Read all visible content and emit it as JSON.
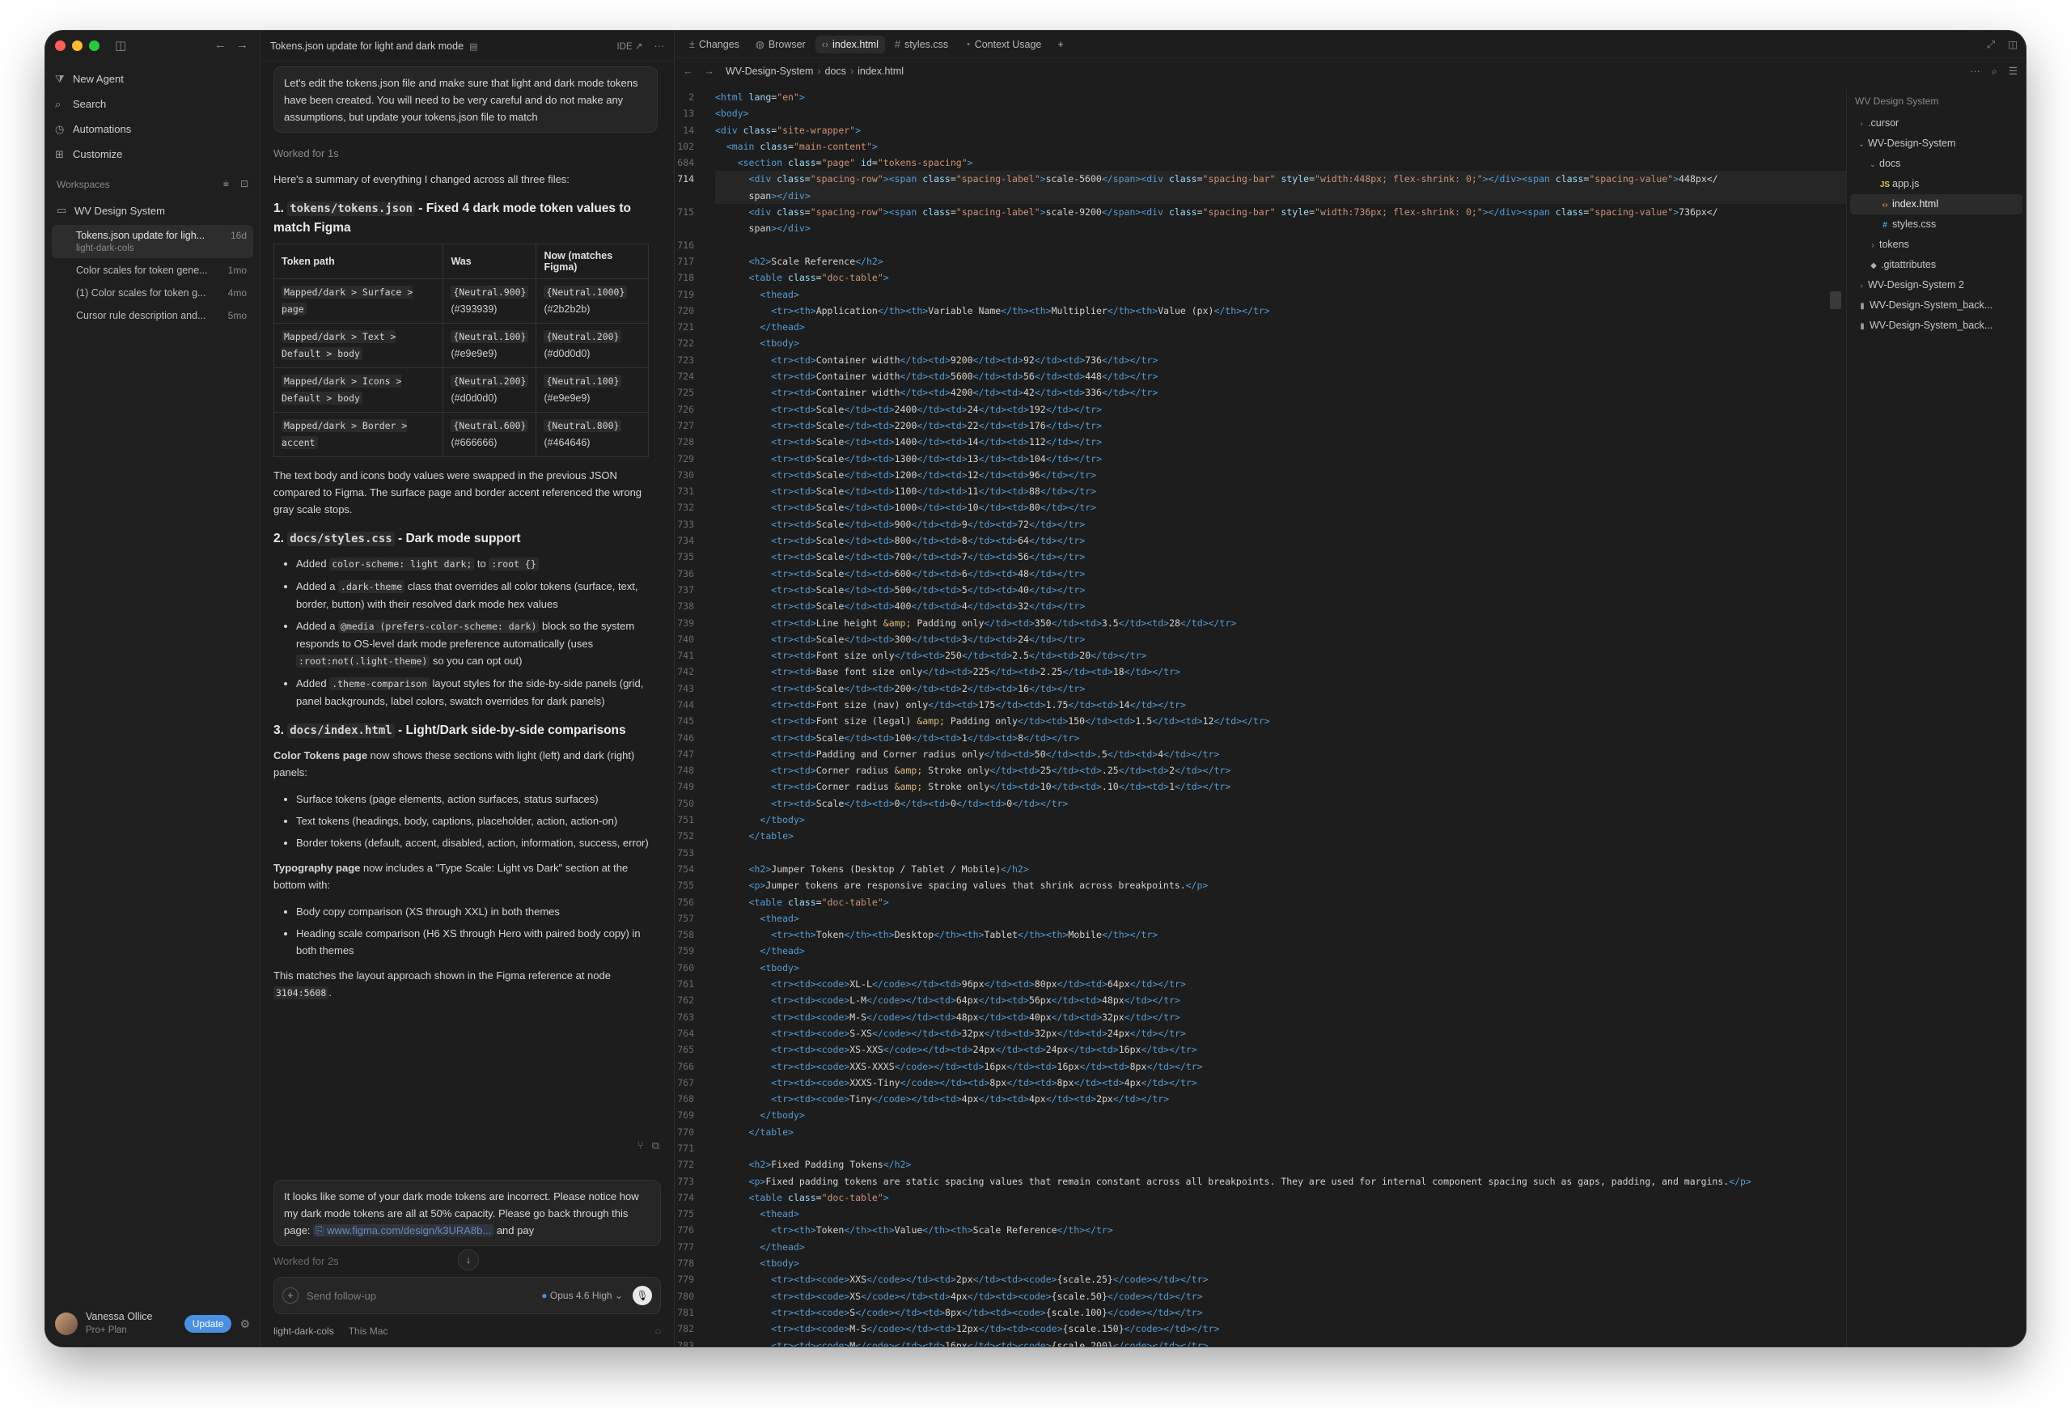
{
  "sidebar": {
    "menu": [
      {
        "icon": "agent-icon",
        "glyph": "⧩",
        "label": "New Agent"
      },
      {
        "icon": "search-icon",
        "glyph": "⌕",
        "label": "Search"
      },
      {
        "icon": "clock-icon",
        "glyph": "◷",
        "label": "Automations"
      },
      {
        "icon": "customize-icon",
        "glyph": "⊞",
        "label": "Customize"
      }
    ],
    "workspaces_label": "Workspaces",
    "workspace_name": "WV Design System",
    "threads": [
      {
        "title": "Tokens.json update for ligh...",
        "sub": "light-dark-cols",
        "age": "16d",
        "active": true
      },
      {
        "title": "Color scales for token gene...",
        "sub": "",
        "age": "1mo",
        "active": false
      },
      {
        "title": "(1) Color scales for token g...",
        "sub": "",
        "age": "4mo",
        "active": false
      },
      {
        "title": "Cursor rule description and...",
        "sub": "",
        "age": "5mo",
        "active": false
      }
    ],
    "user": {
      "name": "Vanessa Ollice",
      "plan": "Pro+ Plan",
      "update_label": "Update"
    }
  },
  "chat": {
    "title": "Tokens.json update for light and dark mode",
    "ide_label": "IDE ↗",
    "user_message": "Let's edit the tokens.json file and make sure that light and dark mode tokens have been created. You will need to be very careful and do not make any assumptions, but update your tokens.json file to match",
    "worked1": "Worked for 1s",
    "summary": "Here's a summary of everything I changed across all three files:",
    "s1_num": "1.",
    "s1_code": "tokens/tokens.json",
    "s1_rest": " - Fixed 4 dark mode token values to match Figma",
    "table_headers": [
      "Token path",
      "Was",
      "Now (matches Figma)"
    ],
    "table_rows": [
      {
        "path": "Mapped/dark > Surface > page",
        "was_token": "{Neutral.900}",
        "was_hex": "(#393939)",
        "now_token": "{Neutral.1000}",
        "now_hex": "(#2b2b2b)"
      },
      {
        "path": "Mapped/dark > Text > Default > body",
        "was_token": "{Neutral.100}",
        "was_hex": "(#e9e9e9)",
        "now_token": "{Neutral.200}",
        "now_hex": "(#d0d0d0)"
      },
      {
        "path": "Mapped/dark > Icons > Default > body",
        "was_token": "{Neutral.200}",
        "was_hex": "(#d0d0d0)",
        "now_token": "{Neutral.100}",
        "now_hex": "(#e9e9e9)"
      },
      {
        "path": "Mapped/dark > Border > accent",
        "was_token": "{Neutral.600}",
        "was_hex": "(#666666)",
        "now_token": "{Neutral.800}",
        "now_hex": "(#464646)"
      }
    ],
    "para1": "The text body and icons body values were swapped in the previous JSON compared to Figma. The surface page and border accent referenced the wrong gray scale stops.",
    "s2_num": "2.",
    "s2_code": "docs/styles.css",
    "s2_rest": " - Dark mode support",
    "s2_bullets": [
      {
        "pre": "Added ",
        "code": "color-scheme: light dark;",
        "mid": " to ",
        "code2": ":root {}",
        "post": ""
      },
      {
        "pre": "Added a ",
        "code": ".dark-theme",
        "mid": " class that overrides all color tokens (surface, text, border, button) with their resolved dark mode hex values",
        "code2": "",
        "post": ""
      },
      {
        "pre": "Added a ",
        "code": "@media (prefers-color-scheme: dark)",
        "mid": " block so the system responds to OS-level dark mode preference automatically (uses ",
        "code2": ":root:not(.light-theme)",
        "post": " so you can opt out)"
      },
      {
        "pre": "Added ",
        "code": ".theme-comparison",
        "mid": " layout styles for the side-by-side panels (grid, panel backgrounds, label colors, swatch overrides for dark panels)",
        "code2": "",
        "post": ""
      }
    ],
    "s3_num": "3.",
    "s3_code": "docs/index.html",
    "s3_rest": " - Light/Dark side-by-side comparisons",
    "color_page_bold": "Color Tokens page",
    "color_page_rest": " now shows these sections with light (left) and dark (right) panels:",
    "s3_bullets_a": [
      "Surface tokens (page elements, action surfaces, status surfaces)",
      "Text tokens (headings, body, captions, placeholder, action, action-on)",
      "Border tokens (default, accent, disabled, action, information, success, error)"
    ],
    "typo_bold": "Typography page",
    "typo_rest": " now includes a \"Type Scale: Light vs Dark\" section at the bottom with:",
    "s3_bullets_b": [
      "Body copy comparison (XS through XXL) in both themes",
      "Heading scale comparison (H6 XS through Hero with paired body copy) in both themes"
    ],
    "closing_pre": "This matches the layout approach shown in the Figma reference at node ",
    "closing_code": "3104:5608",
    "closing_post": ".",
    "user_message2_pre": "It looks like some of your dark mode tokens are incorrect. Please notice how my dark mode tokens are all at 50% capacity. Please go back through this page: ",
    "user_message2_link": "⎘ www.figma.com/design/k3URA8b...",
    "user_message2_post": " and pay",
    "worked2": "Worked for 2s",
    "composer_placeholder": "Send follow-up",
    "model_label": "Opus 4.6 High",
    "footer_branch": "light-dark-cols",
    "footer_location": "This Mac"
  },
  "editor": {
    "tabs": [
      {
        "icon": "changes-icon",
        "glyph": "±",
        "label": "Changes",
        "active": false
      },
      {
        "icon": "globe-icon",
        "glyph": "◍",
        "label": "Browser",
        "active": false
      },
      {
        "icon": "code-icon",
        "glyph": "‹›",
        "label": "index.html",
        "active": true
      },
      {
        "icon": "hash-icon",
        "glyph": "#",
        "label": "styles.css",
        "active": false
      },
      {
        "icon": "pie-icon",
        "glyph": "◔",
        "label": "Context Usage",
        "active": false
      }
    ],
    "breadcrumb": [
      "WV-Design-System",
      "docs",
      "index.html"
    ],
    "current_line": "714",
    "lines": [
      {
        "n": "2",
        "s": "<html lang=\"en\">"
      },
      {
        "n": "13",
        "s": "<body>"
      },
      {
        "n": "14",
        "s": "<div class=\"site-wrapper\">"
      },
      {
        "n": "102",
        "s": "  <main class=\"main-content\">"
      },
      {
        "n": "684",
        "s": "    <section class=\"page\" id=\"tokens-spacing\">"
      },
      {
        "n": "714",
        "s": "      <div class=\"spacing-row\"><span class=\"spacing-label\">scale-5600</span><div class=\"spacing-bar\" style=\"width:448px; flex-shrink: 0;\"></div><span class=\"spacing-value\">448px</"
      },
      {
        "n": "",
        "s": "      span></div>"
      },
      {
        "n": "715",
        "s": "      <div class=\"spacing-row\"><span class=\"spacing-label\">scale-9200</span><div class=\"spacing-bar\" style=\"width:736px; flex-shrink: 0;\"></div><span class=\"spacing-value\">736px</"
      },
      {
        "n": "",
        "s": "      span></div>"
      },
      {
        "n": "716",
        "s": ""
      },
      {
        "n": "717",
        "s": "      <h2>Scale Reference</h2>"
      },
      {
        "n": "718",
        "s": "      <table class=\"doc-table\">"
      },
      {
        "n": "719",
        "s": "        <thead>"
      },
      {
        "n": "720",
        "s": "          <tr><th>Application</th><th>Variable Name</th><th>Multiplier</th><th>Value (px)</th></tr>"
      },
      {
        "n": "721",
        "s": "        </thead>"
      },
      {
        "n": "722",
        "s": "        <tbody>"
      },
      {
        "n": "723",
        "s": "          <tr><td>Container width</td><td>9200</td><td>92</td><td>736</td></tr>"
      },
      {
        "n": "724",
        "s": "          <tr><td>Container width</td><td>5600</td><td>56</td><td>448</td></tr>"
      },
      {
        "n": "725",
        "s": "          <tr><td>Container width</td><td>4200</td><td>42</td><td>336</td></tr>"
      },
      {
        "n": "726",
        "s": "          <tr><td>Scale</td><td>2400</td><td>24</td><td>192</td></tr>"
      },
      {
        "n": "727",
        "s": "          <tr><td>Scale</td><td>2200</td><td>22</td><td>176</td></tr>"
      },
      {
        "n": "728",
        "s": "          <tr><td>Scale</td><td>1400</td><td>14</td><td>112</td></tr>"
      },
      {
        "n": "729",
        "s": "          <tr><td>Scale</td><td>1300</td><td>13</td><td>104</td></tr>"
      },
      {
        "n": "730",
        "s": "          <tr><td>Scale</td><td>1200</td><td>12</td><td>96</td></tr>"
      },
      {
        "n": "731",
        "s": "          <tr><td>Scale</td><td>1100</td><td>11</td><td>88</td></tr>"
      },
      {
        "n": "732",
        "s": "          <tr><td>Scale</td><td>1000</td><td>10</td><td>80</td></tr>"
      },
      {
        "n": "733",
        "s": "          <tr><td>Scale</td><td>900</td><td>9</td><td>72</td></tr>"
      },
      {
        "n": "734",
        "s": "          <tr><td>Scale</td><td>800</td><td>8</td><td>64</td></tr>"
      },
      {
        "n": "735",
        "s": "          <tr><td>Scale</td><td>700</td><td>7</td><td>56</td></tr>"
      },
      {
        "n": "736",
        "s": "          <tr><td>Scale</td><td>600</td><td>6</td><td>48</td></tr>"
      },
      {
        "n": "737",
        "s": "          <tr><td>Scale</td><td>500</td><td>5</td><td>40</td></tr>"
      },
      {
        "n": "738",
        "s": "          <tr><td>Scale</td><td>400</td><td>4</td><td>32</td></tr>"
      },
      {
        "n": "739",
        "s": "          <tr><td>Line height &amp; Padding only</td><td>350</td><td>3.5</td><td>28</td></tr>"
      },
      {
        "n": "740",
        "s": "          <tr><td>Scale</td><td>300</td><td>3</td><td>24</td></tr>"
      },
      {
        "n": "741",
        "s": "          <tr><td>Font size only</td><td>250</td><td>2.5</td><td>20</td></tr>"
      },
      {
        "n": "742",
        "s": "          <tr><td>Base font size only</td><td>225</td><td>2.25</td><td>18</td></tr>"
      },
      {
        "n": "743",
        "s": "          <tr><td>Scale</td><td>200</td><td>2</td><td>16</td></tr>"
      },
      {
        "n": "744",
        "s": "          <tr><td>Font size (nav) only</td><td>175</td><td>1.75</td><td>14</td></tr>"
      },
      {
        "n": "745",
        "s": "          <tr><td>Font size (legal) &amp; Padding only</td><td>150</td><td>1.5</td><td>12</td></tr>"
      },
      {
        "n": "746",
        "s": "          <tr><td>Scale</td><td>100</td><td>1</td><td>8</td></tr>"
      },
      {
        "n": "747",
        "s": "          <tr><td>Padding and Corner radius only</td><td>50</td><td>.5</td><td>4</td></tr>"
      },
      {
        "n": "748",
        "s": "          <tr><td>Corner radius &amp; Stroke only</td><td>25</td><td>.25</td><td>2</td></tr>"
      },
      {
        "n": "749",
        "s": "          <tr><td>Corner radius &amp; Stroke only</td><td>10</td><td>.10</td><td>1</td></tr>"
      },
      {
        "n": "750",
        "s": "          <tr><td>Scale</td><td>0</td><td>0</td><td>0</td></tr>"
      },
      {
        "n": "751",
        "s": "        </tbody>"
      },
      {
        "n": "752",
        "s": "      </table>"
      },
      {
        "n": "753",
        "s": ""
      },
      {
        "n": "754",
        "s": "      <h2>Jumper Tokens (Desktop / Tablet / Mobile)</h2>"
      },
      {
        "n": "755",
        "s": "      <p>Jumper tokens are responsive spacing values that shrink across breakpoints.</p>"
      },
      {
        "n": "756",
        "s": "      <table class=\"doc-table\">"
      },
      {
        "n": "757",
        "s": "        <thead>"
      },
      {
        "n": "758",
        "s": "          <tr><th>Token</th><th>Desktop</th><th>Tablet</th><th>Mobile</th></tr>"
      },
      {
        "n": "759",
        "s": "        </thead>"
      },
      {
        "n": "760",
        "s": "        <tbody>"
      },
      {
        "n": "761",
        "s": "          <tr><td><code>XL-L</code></td><td>96px</td><td>80px</td><td>64px</td></tr>"
      },
      {
        "n": "762",
        "s": "          <tr><td><code>L-M</code></td><td>64px</td><td>56px</td><td>48px</td></tr>"
      },
      {
        "n": "763",
        "s": "          <tr><td><code>M-S</code></td><td>48px</td><td>40px</td><td>32px</td></tr>"
      },
      {
        "n": "764",
        "s": "          <tr><td><code>S-XS</code></td><td>32px</td><td>32px</td><td>24px</td></tr>"
      },
      {
        "n": "765",
        "s": "          <tr><td><code>XS-XXS</code></td><td>24px</td><td>24px</td><td>16px</td></tr>"
      },
      {
        "n": "766",
        "s": "          <tr><td><code>XXS-XXXS</code></td><td>16px</td><td>16px</td><td>8px</td></tr>"
      },
      {
        "n": "767",
        "s": "          <tr><td><code>XXXS-Tiny</code></td><td>8px</td><td>8px</td><td>4px</td></tr>"
      },
      {
        "n": "768",
        "s": "          <tr><td><code>Tiny</code></td><td>4px</td><td>4px</td><td>2px</td></tr>"
      },
      {
        "n": "769",
        "s": "        </tbody>"
      },
      {
        "n": "770",
        "s": "      </table>"
      },
      {
        "n": "771",
        "s": ""
      },
      {
        "n": "772",
        "s": "      <h2>Fixed Padding Tokens</h2>"
      },
      {
        "n": "773",
        "s": "      <p>Fixed padding tokens are static spacing values that remain constant across all breakpoints. They are used for internal component spacing such as gaps, padding, and margins.</p>"
      },
      {
        "n": "774",
        "s": "      <table class=\"doc-table\">"
      },
      {
        "n": "775",
        "s": "        <thead>"
      },
      {
        "n": "776",
        "s": "          <tr><th>Token</th><th>Value</th><th>Scale Reference</th></tr>"
      },
      {
        "n": "777",
        "s": "        </thead>"
      },
      {
        "n": "778",
        "s": "        <tbody>"
      },
      {
        "n": "779",
        "s": "          <tr><td><code>XXS</code></td><td>2px</td><td><code>{scale.25}</code></td></tr>"
      },
      {
        "n": "780",
        "s": "          <tr><td><code>XS</code></td><td>4px</td><td><code>{scale.50}</code></td></tr>"
      },
      {
        "n": "781",
        "s": "          <tr><td><code>S</code></td><td>8px</td><td><code>{scale.100}</code></td></tr>"
      },
      {
        "n": "782",
        "s": "          <tr><td><code>M-S</code></td><td>12px</td><td><code>{scale.150}</code></td></tr>"
      },
      {
        "n": "783",
        "s": "          <tr><td><code>M</code></td><td>16px</td><td><code>{scale.200}</code></td></tr>"
      }
    ],
    "explorer": {
      "title": "WV Design System",
      "items": [
        {
          "label": ".cursor",
          "kind": "folder",
          "indent": 0,
          "open": false,
          "active": false
        },
        {
          "label": "WV-Design-System",
          "kind": "folder",
          "indent": 0,
          "open": true,
          "active": false
        },
        {
          "label": "docs",
          "kind": "folder",
          "indent": 1,
          "open": true,
          "active": false
        },
        {
          "label": "app.js",
          "kind": "js",
          "indent": 2,
          "active": false
        },
        {
          "label": "index.html",
          "kind": "html",
          "indent": 2,
          "active": true
        },
        {
          "label": "styles.css",
          "kind": "css",
          "indent": 2,
          "active": false
        },
        {
          "label": "tokens",
          "kind": "folder",
          "indent": 1,
          "open": false,
          "active": false
        },
        {
          "label": ".gitattributes",
          "kind": "git",
          "indent": 1,
          "active": false
        },
        {
          "label": "WV-Design-System 2",
          "kind": "folder",
          "indent": 0,
          "open": false,
          "active": false
        },
        {
          "label": "WV-Design-System_back...",
          "kind": "file",
          "indent": 0,
          "active": false
        },
        {
          "label": "WV-Design-System_back...",
          "kind": "file",
          "indent": 0,
          "active": false
        }
      ]
    }
  },
  "colors": {
    "tag": "#569cd6",
    "attr": "#9cdcfe",
    "string": "#ce9178",
    "entity": "#d7ba7d",
    "accent": "#4a90e2",
    "js": "#e8c547",
    "html": "#e8834a",
    "css": "#56a8e0"
  }
}
